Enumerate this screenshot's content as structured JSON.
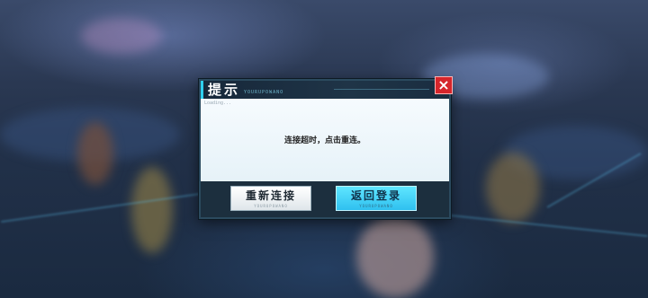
{
  "dialog": {
    "title": "提示",
    "title_sub": "YOURUPOWANO",
    "close_symbol": "×",
    "content_tag": "Loading...",
    "message": "连接超时，点击重连。",
    "buttons": {
      "reconnect_label": "重新连接",
      "reconnect_sub": "YOURUPOWANO",
      "back_label": "返回登录",
      "back_sub": "YOURUPOWANO"
    }
  },
  "colors": {
    "accent_cyan": "#2fd0ef",
    "close_red": "#d6252b",
    "panel_dark": "#1c2f3e"
  },
  "icons": {
    "close": "close-icon"
  }
}
